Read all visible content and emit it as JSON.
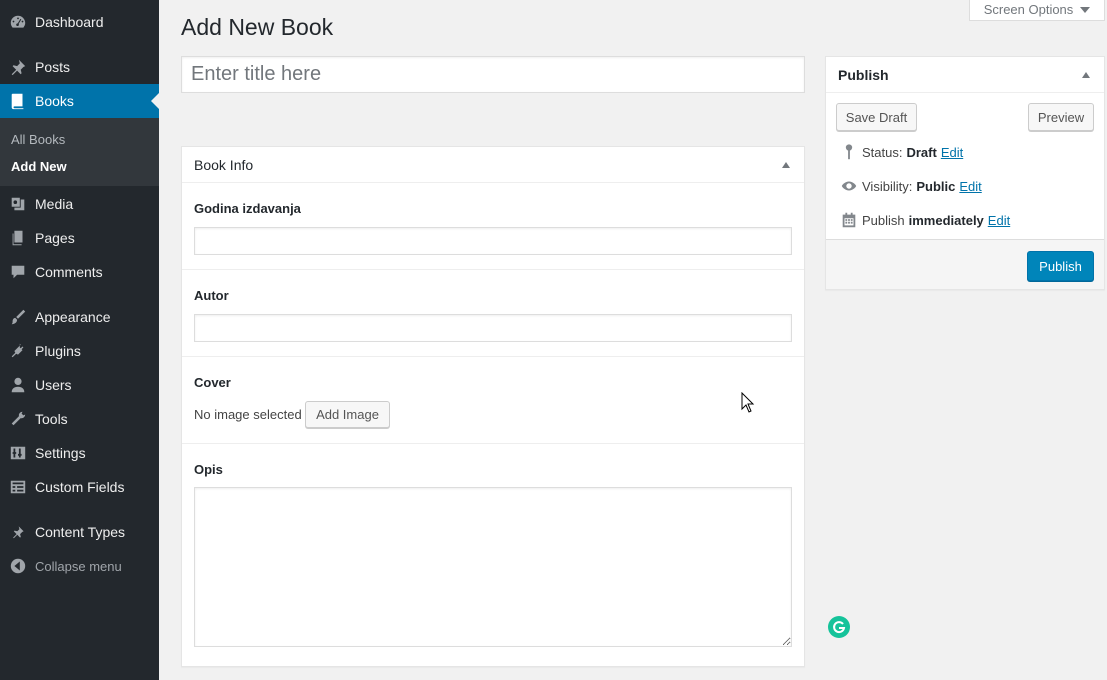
{
  "sidebar": {
    "items": [
      {
        "label": "Dashboard",
        "icon": "dashboard-icon"
      },
      {
        "label": "Posts",
        "icon": "pin-icon"
      },
      {
        "label": "Books",
        "icon": "book-icon"
      },
      {
        "label": "Media",
        "icon": "media-icon"
      },
      {
        "label": "Pages",
        "icon": "pages-icon"
      },
      {
        "label": "Comments",
        "icon": "comment-icon"
      },
      {
        "label": "Appearance",
        "icon": "brush-icon"
      },
      {
        "label": "Plugins",
        "icon": "plug-icon"
      },
      {
        "label": "Users",
        "icon": "user-icon"
      },
      {
        "label": "Tools",
        "icon": "wrench-icon"
      },
      {
        "label": "Settings",
        "icon": "settings-icon"
      },
      {
        "label": "Custom Fields",
        "icon": "table-icon"
      },
      {
        "label": "Content Types",
        "icon": "pin-icon"
      }
    ],
    "submenu": [
      {
        "label": "All Books"
      },
      {
        "label": "Add New"
      }
    ],
    "collapse_label": "Collapse menu",
    "accent_color": "#0073aa",
    "background_color": "#23282d"
  },
  "screen_options": {
    "label": "Screen Options"
  },
  "page": {
    "title": "Add New Book",
    "title_placeholder": "Enter title here"
  },
  "book_info": {
    "heading": "Book Info",
    "fields": [
      {
        "label": "Godina izdavanja",
        "value": ""
      },
      {
        "label": "Autor",
        "value": ""
      },
      {
        "label": "Cover",
        "no_image_text": "No image selected",
        "button_label": "Add Image"
      },
      {
        "label": "Opis",
        "value": ""
      }
    ]
  },
  "publish": {
    "heading": "Publish",
    "save_draft_label": "Save Draft",
    "preview_label": "Preview",
    "status_label": "Status:",
    "status_value": "Draft",
    "visibility_label": "Visibility:",
    "visibility_value": "Public",
    "schedule_label": "Publish",
    "schedule_value": "immediately",
    "edit_label": "Edit",
    "publish_button_label": "Publish",
    "button_color": "#0085ba"
  }
}
